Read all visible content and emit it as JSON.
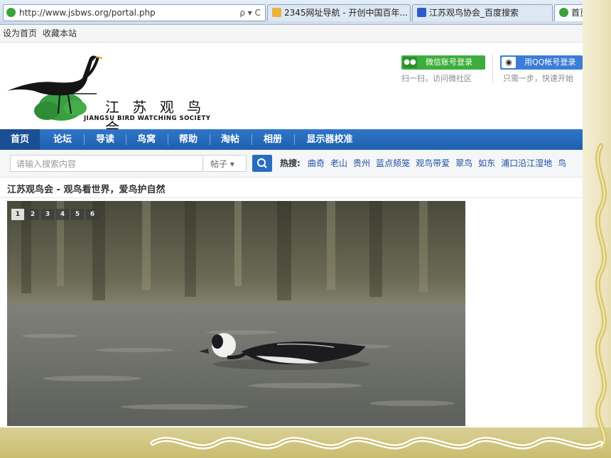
{
  "browser": {
    "url": "http://www.jsbws.org/portal.php",
    "address_tools": "ρ ▾ C",
    "tabs": [
      {
        "label": "2345网址导航 - 开创中国百年..."
      },
      {
        "label": "江苏观鸟协会_百度搜索"
      },
      {
        "label": "首页"
      }
    ]
  },
  "topline": {
    "set_home": "设为首页",
    "bookmark": "收藏本站"
  },
  "logo": {
    "cn": "江 苏 观 鸟 会",
    "en": "JIANGSU BIRD WATCHING SOCIETY"
  },
  "login": {
    "wechat_label": "微信账号登录",
    "wechat_sub": "扫一扫，访问微社区",
    "qq_label": "用QQ帐号登录",
    "qq_sub": "只需一步，快速开始"
  },
  "nav": [
    "首页",
    "论坛",
    "导读",
    "鸟窝",
    "帮助",
    "淘帖",
    "相册",
    "显示器校准"
  ],
  "search": {
    "placeholder": "请输入搜索内容",
    "type": "帖子 ▾",
    "hot_label": "热搜:",
    "hot_terms": [
      "曲奇",
      "老山",
      "贵州",
      "蓝点颏笼",
      "观鸟带爱",
      "翠鸟",
      "如东",
      "浦口沿江湿地",
      "鸟"
    ]
  },
  "tagline": "江苏观鸟会 - 观鸟看世界，爱鸟护自然",
  "slider": {
    "pages": [
      "1",
      "2",
      "3",
      "4",
      "5",
      "6"
    ],
    "active": 0
  },
  "colors": {
    "nav_blue": "#2f76c8",
    "wechat_green": "#3cae3c",
    "qq_blue": "#3b7dd8",
    "link_blue": "#1f4fa0"
  }
}
